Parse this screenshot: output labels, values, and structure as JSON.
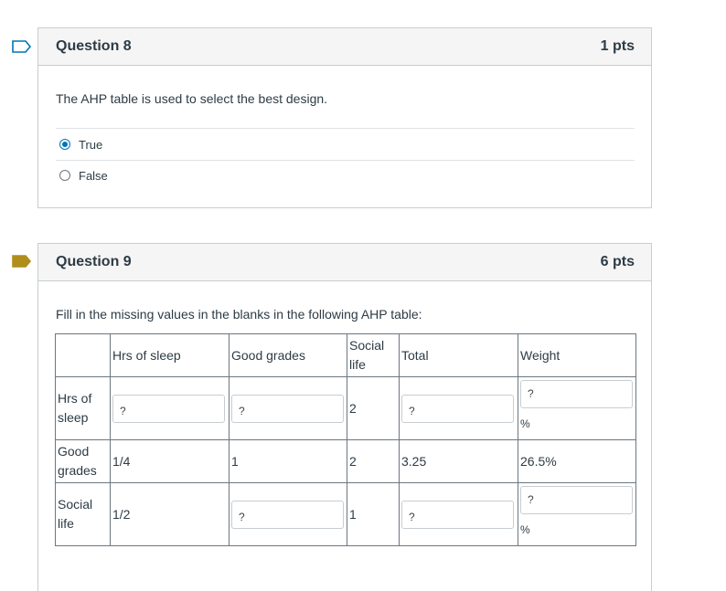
{
  "colors": {
    "accent": "#0374b5",
    "flag_outline": "#0374b5",
    "flag_filled": "#b08e1a",
    "border": "#c7cdd1",
    "header_bg": "#f5f5f5"
  },
  "q8": {
    "flag_icon": "flag-outline-icon",
    "title": "Question 8",
    "points": "1 pts",
    "text": "The AHP table is used to select the best design.",
    "answers": [
      {
        "label": "True",
        "selected": true
      },
      {
        "label": "False",
        "selected": false
      }
    ]
  },
  "q9": {
    "flag_icon": "flag-filled-icon",
    "title": "Question 9",
    "points": "6 pts",
    "text": "Fill in the missing values in the blanks in the following AHP table:",
    "table": {
      "headers": [
        "",
        "Hrs of sleep",
        "Good grades",
        "Social life",
        "Total",
        "Weight"
      ],
      "rows": [
        {
          "label": "Hrs of sleep",
          "c1": "?",
          "c2": "?",
          "c3": "2",
          "c4": "?",
          "c5": "?",
          "c5_unit": "%"
        },
        {
          "label": "Good grades",
          "c1": "1/4",
          "c2": "1",
          "c3": "2",
          "c4": "3.25",
          "c5": "26.5%"
        },
        {
          "label": "Social life",
          "c1": "1/2",
          "c2": "?",
          "c3": "1",
          "c4": "?",
          "c5": "?",
          "c5_unit": "%"
        }
      ]
    }
  }
}
